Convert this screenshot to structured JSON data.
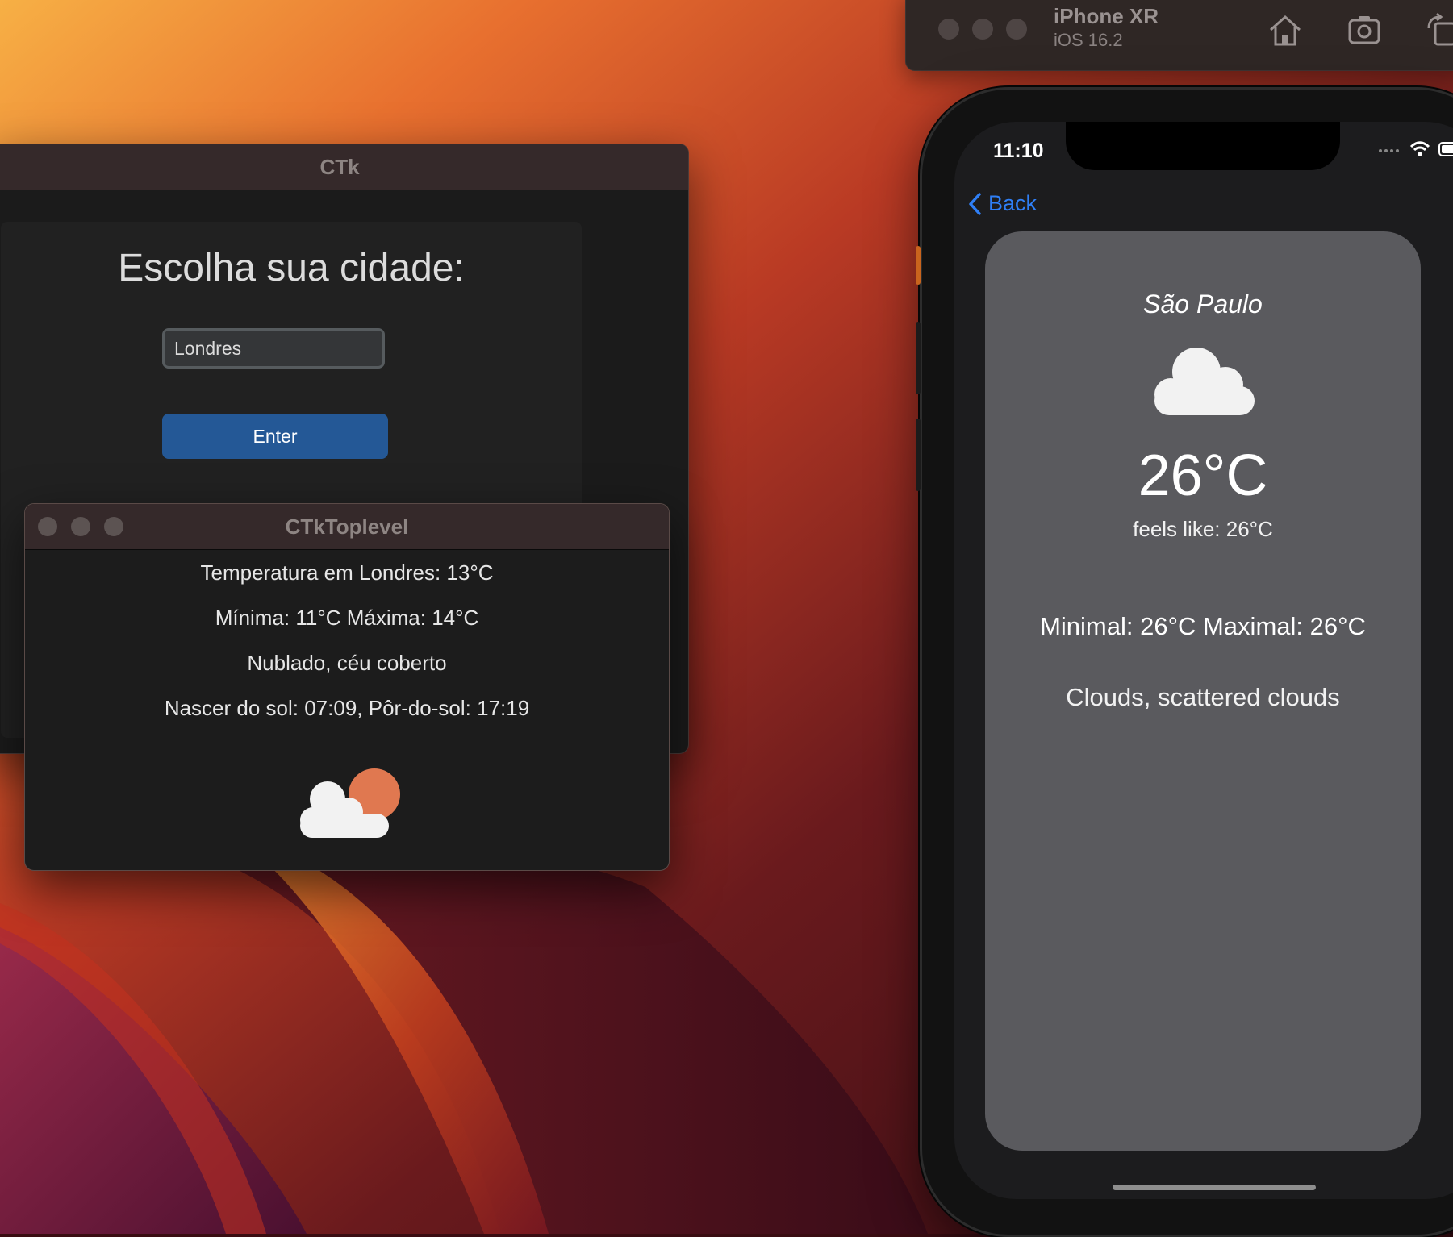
{
  "ctk": {
    "title": "CTk",
    "heading": "Escolha sua cidade:",
    "city_input_value": "Londres",
    "enter_label": "Enter"
  },
  "toplevel": {
    "title": "CTkToplevel",
    "temperature": "Temperatura em Londres: 13°C",
    "minmax": "Mínima: 11°C Máxima: 14°C",
    "description": "Nublado, céu coberto",
    "sun_times": "Nascer do sol: 07:09, Pôr-do-sol: 17:19",
    "weather_icon": "cloud-sun-icon"
  },
  "simulator": {
    "device": "iPhone XR",
    "os": "iOS 16.2",
    "toolbar_icons": [
      "home-icon",
      "screenshot-icon",
      "rotate-icon"
    ]
  },
  "iphone": {
    "status_time": "11:10",
    "back_label": "Back",
    "city": "São Paulo",
    "weather_icon": "cloud-icon",
    "temperature": "26°C",
    "feels_like": "feels like: 26°C",
    "minmax": "Minimal: 26°C Maximal: 26°C",
    "description": "Clouds, scattered clouds"
  },
  "colors": {
    "ctk_button": "#245896",
    "ios_accent": "#2f7ff6",
    "card_bg": "#5a5a5e",
    "sun": "#e07850"
  }
}
